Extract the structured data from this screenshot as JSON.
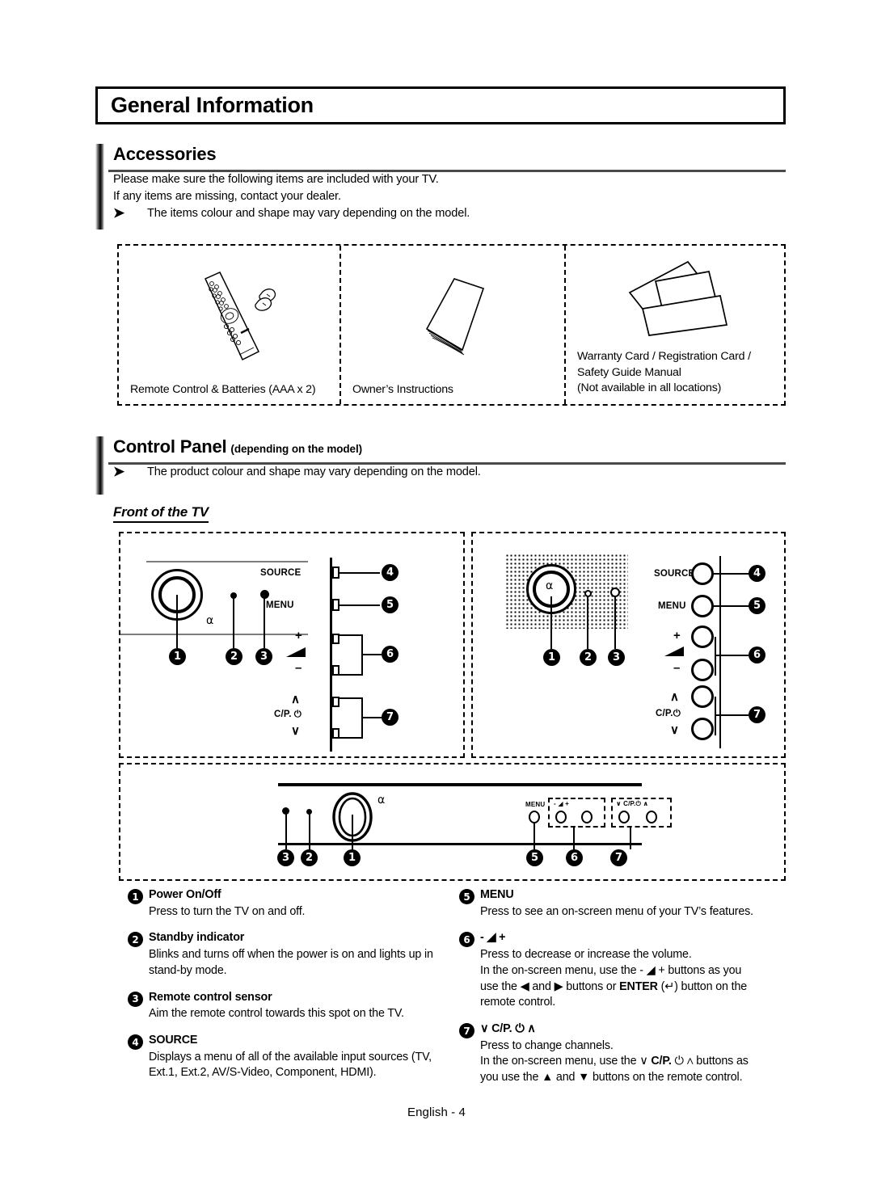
{
  "page": {
    "title": "General Information",
    "footer": "English - 4"
  },
  "accessories": {
    "heading": "Accessories",
    "intro_line1": "Please make sure the following items are included with your TV.",
    "intro_line2": "If any items are missing, contact your dealer.",
    "note_arrow": "➤",
    "note": "The items colour and shape may vary depending on the model.",
    "items": [
      {
        "icon": "remote-control-icon",
        "label": "Remote Control & Batteries (AAA x 2)"
      },
      {
        "icon": "manual-booklet-icon",
        "label": "Owner’s Instructions"
      },
      {
        "icon": "warranty-cards-icon",
        "label": "Warranty Card / Registration Card /\nSafety Guide Manual\n(Not available in all locations)",
        "label_lines": [
          "Warranty Card / Registration Card /",
          "Safety Guide Manual",
          "(Not available in all locations)"
        ]
      }
    ]
  },
  "control_panel": {
    "heading": "Control Panel",
    "heading_sub": "(depending on the model)",
    "note_arrow": "➤",
    "note": "The product colour and shape may vary depending on the model.",
    "front_heading": "Front of the TV",
    "diagram_labels": {
      "source": "SOURCE",
      "menu": "MENU",
      "plus": "+",
      "minus": "–",
      "volume_icon": "volume-wedge-icon",
      "chan_up": "∧",
      "chan_down": "∨",
      "cp": "C/P.",
      "power_symbol": "⏻",
      "bottom_menu": "MENU",
      "bottom_vol": "-   ◢   +",
      "bottom_cp": "∨ C/P.⏻ ∧"
    },
    "callouts": [
      "1",
      "2",
      "3",
      "4",
      "5",
      "6",
      "7"
    ]
  },
  "legend": {
    "left": [
      {
        "num": "1",
        "title": "Power On/Off",
        "desc": "Press to turn the TV on and off."
      },
      {
        "num": "2",
        "title": "Standby indicator",
        "desc": "Blinks and turns off when the power is on and lights up in stand-by mode."
      },
      {
        "num": "3",
        "title": "Remote control sensor",
        "desc": "Aim the remote control towards this spot on the TV."
      },
      {
        "num": "4",
        "title": "SOURCE",
        "desc": "Displays a menu of all of the available input sources (TV, Ext.1, Ext.2, AV/S-Video, Component, HDMI)."
      }
    ],
    "right": [
      {
        "num": "5",
        "title": "MENU",
        "desc": "Press to see an on-screen menu of your TV’s features."
      },
      {
        "num": "6",
        "title": "-  ◢  +",
        "desc_line1": "Press to decrease or increase the volume.",
        "desc_line2": "In the on-screen menu, use the -  ◢  + buttons as you",
        "desc_line3_a": "use the ◀ and ▶ buttons or ",
        "desc_line3_b": "ENTER",
        "desc_line3_c": " (↵) button on the",
        "desc_line4": "remote control."
      },
      {
        "num": "7",
        "title": "∨ C/P. ⏻ ∧",
        "desc_line1": "Press to change channels.",
        "desc_line2_a": "In the on-screen menu, use the ∨ ",
        "desc_line2_b": "C/P.",
        "desc_line2_c": " ⏻ ∧ buttons as",
        "desc_line3": "you use the ▲ and ▼ buttons on the remote control."
      }
    ]
  },
  "colors": {
    "ink": "#000000",
    "rule": "#4a4a4a",
    "bezel": "#7d7d7d"
  }
}
